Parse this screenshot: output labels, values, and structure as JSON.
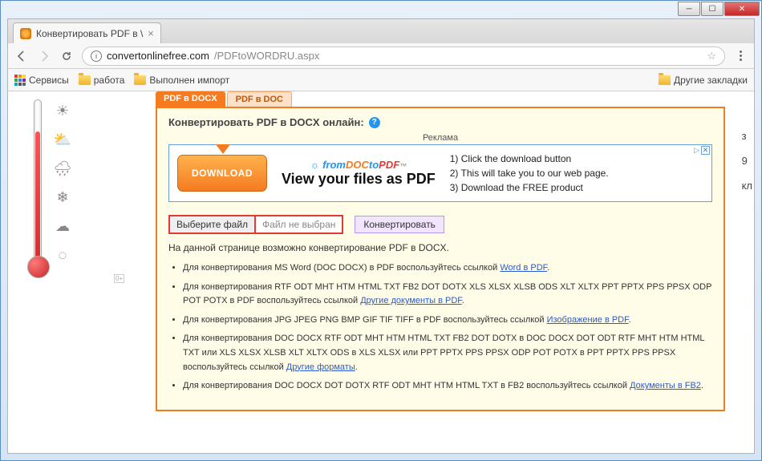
{
  "window": {
    "tab_title": "Конвертировать PDF в \\",
    "url_domain": "convertonlinefree.com",
    "url_path": "/PDFtoWORDRU.aspx"
  },
  "bookmarks": {
    "apps": "Сервисы",
    "b1": "работа",
    "b2": "Выполнен импорт",
    "other": "Другие закладки"
  },
  "side": {
    "s1": "з",
    "s2": "9",
    "s3": "кл"
  },
  "tabs": {
    "active": "PDF в DOCX",
    "inactive": "PDF в DOC"
  },
  "panel": {
    "heading": "Конвертировать PDF в DOCX онлайн:",
    "ad_label": "Реклама"
  },
  "ad": {
    "download": "DOWNLOAD",
    "brand_pre": "☼ from",
    "brand_doc": "DOC",
    "brand_to": "to",
    "brand_pdf": "PDF",
    "brand_tm": "™",
    "slogan": "View your files as PDF",
    "r1": "1) Click the download button",
    "r2": "2) This will take you to our web page.",
    "r3": "3) Download the FREE product"
  },
  "controls": {
    "choose": "Выберите файл",
    "nofile": "Файл не выбран",
    "convert": "Конвертировать"
  },
  "desc": "На данной странице возможно конвертирование PDF в DOCX.",
  "li1": {
    "t1": "Для конвертирования MS Word (DOC DOCX) в PDF воспользуйтесь ссылкой ",
    "a": "Word в PDF",
    "t2": "."
  },
  "li2": {
    "t1": "Для конвертирования RTF ODT MHT HTM HTML TXT FB2 DOT DOTX XLS XLSX XLSB ODS XLT XLTX PPT PPTX PPS PPSX ODP POT POTX в PDF воспользуйтесь ссылкой ",
    "a": "Другие документы в PDF",
    "t2": "."
  },
  "li3": {
    "t1": "Для конвертирования JPG JPEG PNG BMP GIF TIF TIFF в PDF воспользуйтесь ссылкой ",
    "a": "Изображение в PDF",
    "t2": "."
  },
  "li4": {
    "t1": "Для конвертирования DOC DOCX RTF ODT MHT HTM HTML TXT FB2 DOT DOTX в DOC DOCX DOT ODT RTF MHT HTM HTML TXT или XLS XLSX XLSB XLT XLTX ODS в XLS XLSX или PPT PPTX PPS PPSX ODP POT POTX в PPT PPTX PPS PPSX воспользуйтесь ссылкой ",
    "a": "Другие форматы",
    "t2": "."
  },
  "li5": {
    "t1": "Для конвертирования DOC DOCX DOT DOTX RTF ODT MHT HTM HTML TXT в FB2 воспользуйтесь ссылкой ",
    "a": "Документы в FB2",
    "t2": "."
  },
  "badge": "0+"
}
